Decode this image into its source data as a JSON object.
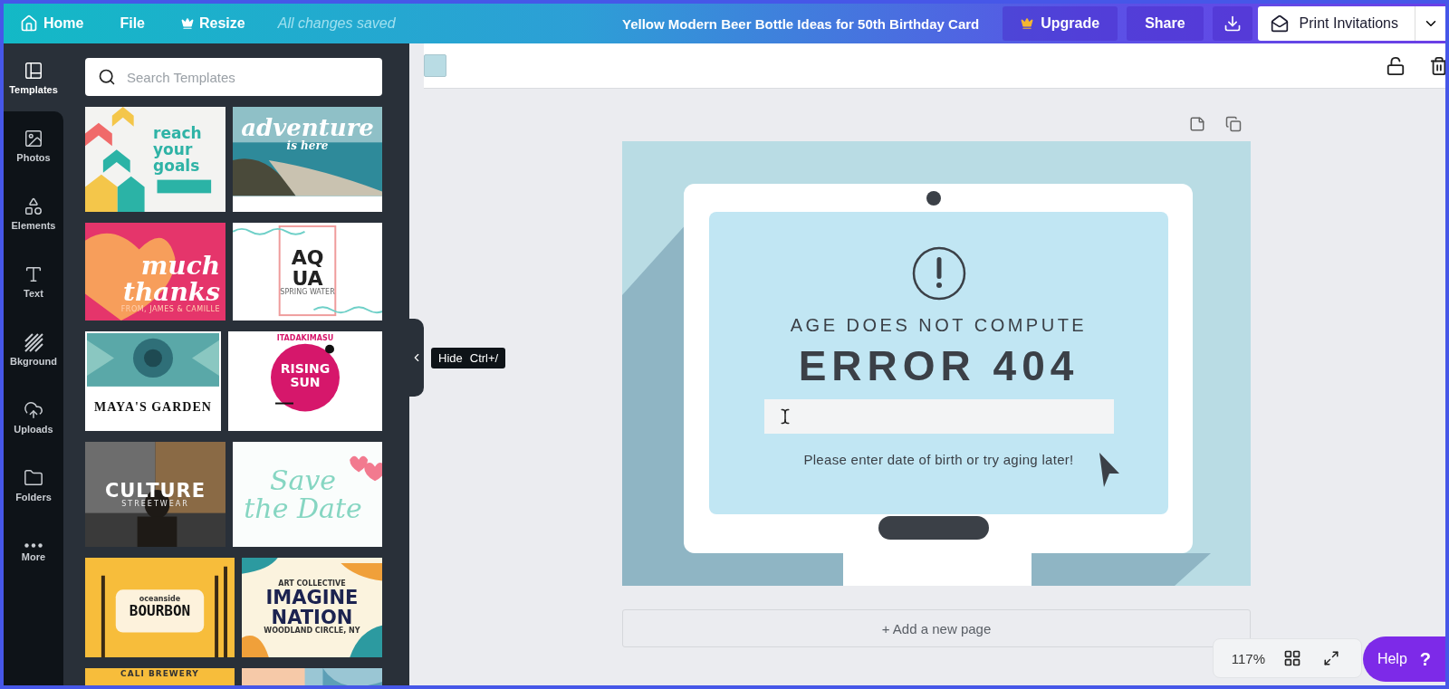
{
  "topbar": {
    "home": "Home",
    "file": "File",
    "resize": "Resize",
    "status": "All changes saved",
    "title": "Yellow Modern Beer Bottle Ideas for 50th Birthday Card",
    "upgrade": "Upgrade",
    "share": "Share",
    "print": "Print Invitations"
  },
  "rail": [
    {
      "label": "Templates",
      "kind": "templates",
      "selected": true
    },
    {
      "label": "Photos",
      "kind": "photos",
      "selected": false
    },
    {
      "label": "Elements",
      "kind": "elements",
      "selected": false
    },
    {
      "label": "Text",
      "kind": "text",
      "selected": false
    },
    {
      "label": "Bkground",
      "kind": "background",
      "selected": false
    },
    {
      "label": "Uploads",
      "kind": "uploads",
      "selected": false
    },
    {
      "label": "Folders",
      "kind": "folders",
      "selected": false
    },
    {
      "label": "More",
      "kind": "more",
      "selected": false
    }
  ],
  "search": {
    "placeholder": "Search Templates"
  },
  "templates": [
    [
      {
        "kind": "goals",
        "texts": [
          {
            "text": "reach your goals",
            "kind": "title"
          }
        ]
      },
      {
        "kind": "adventure",
        "texts": [
          {
            "text": "adventure",
            "kind": "script"
          },
          {
            "text": "is here",
            "kind": "sub"
          }
        ]
      }
    ],
    [
      {
        "kind": "thanks",
        "texts": [
          {
            "text": "much",
            "kind": "script"
          },
          {
            "text": "thanks",
            "kind": "script"
          },
          {
            "text": "FROM, JAMES & CAMILLE",
            "kind": "sub"
          }
        ]
      },
      {
        "kind": "aqua",
        "texts": [
          {
            "text": "AQ",
            "kind": "title"
          },
          {
            "text": "UA",
            "kind": "title"
          },
          {
            "text": "SPRING WATER",
            "kind": "sub"
          }
        ]
      }
    ],
    [
      {
        "kind": "garden",
        "texts": [
          {
            "text": "MAYA'S GARDEN",
            "kind": "title"
          }
        ]
      },
      {
        "kind": "rising",
        "texts": [
          {
            "text": "ITADAKIMASU",
            "kind": "sub"
          },
          {
            "text": "RISING",
            "kind": "title"
          },
          {
            "text": "SUN",
            "kind": "title"
          }
        ]
      }
    ],
    [
      {
        "kind": "culture",
        "texts": [
          {
            "text": "CULTURE",
            "kind": "title"
          },
          {
            "text": "STREETWEAR",
            "kind": "sub"
          }
        ]
      },
      {
        "kind": "date",
        "texts": [
          {
            "text": "Save",
            "kind": "script"
          },
          {
            "text": "the Date",
            "kind": "script"
          }
        ]
      }
    ],
    [
      {
        "kind": "bourbon",
        "texts": [
          {
            "text": "oceanside",
            "kind": "sub"
          },
          {
            "text": "BOURBON",
            "kind": "title"
          }
        ]
      },
      {
        "kind": "imagine",
        "texts": [
          {
            "text": "ART COLLECTIVE",
            "kind": "sub"
          },
          {
            "text": "IMAGINE",
            "kind": "title"
          },
          {
            "text": "NATION",
            "kind": "title"
          },
          {
            "text": "WOODLAND CIRCLE, NY",
            "kind": "sub"
          }
        ]
      }
    ],
    [
      {
        "kind": "cali",
        "texts": [
          {
            "text": "CALI BREWERY",
            "kind": "sub"
          }
        ]
      },
      {
        "kind": "wave"
      }
    ]
  ],
  "hide_tooltip": {
    "label": "Hide",
    "shortcut": "Ctrl+/"
  },
  "design": {
    "subtitle": "AGE DOES NOT COMPUTE",
    "title": "ERROR 404",
    "message": "Please enter date of birth or try aging later!"
  },
  "add_page": "+ Add a new page",
  "zoom": "117%",
  "help": {
    "label": "Help",
    "mark": "?"
  }
}
